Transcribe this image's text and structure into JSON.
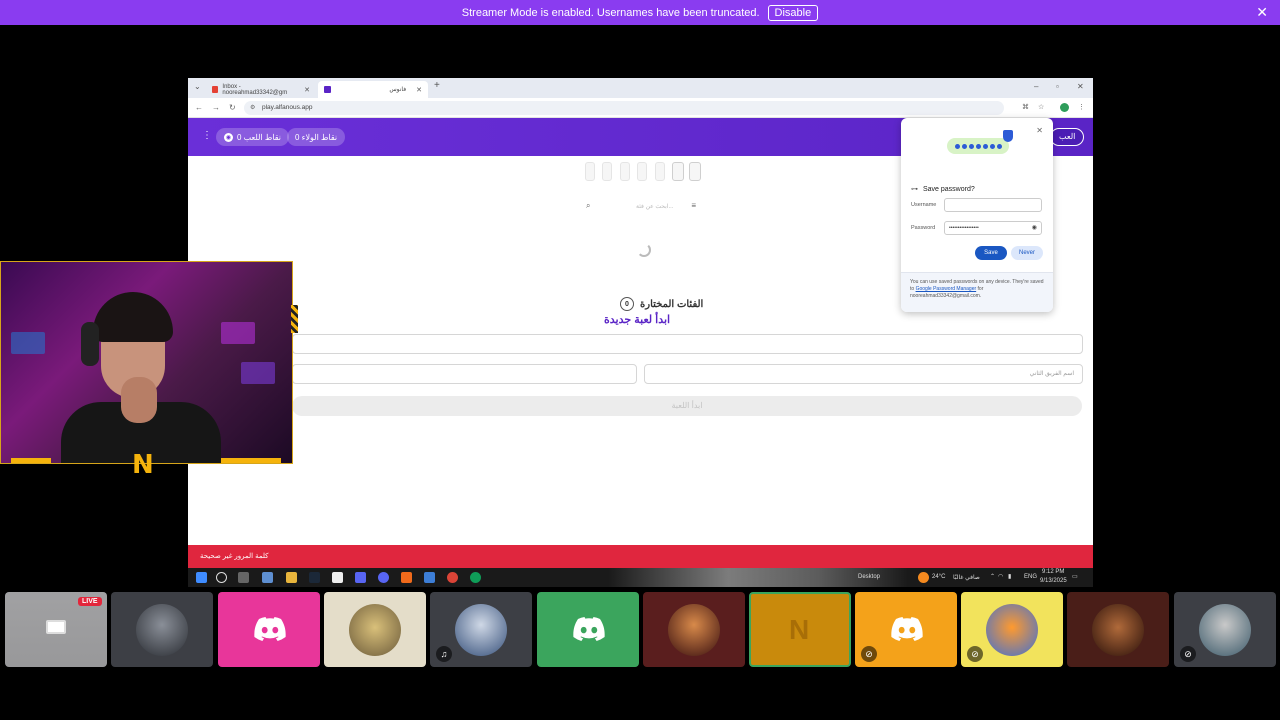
{
  "banner": {
    "message": "Streamer Mode is enabled. Usernames have been truncated.",
    "disable_label": "Disable",
    "close_glyph": "✕"
  },
  "browser": {
    "tabs": [
      {
        "title": "Inbox - nooreahmad33342@gm",
        "icon": "gmail-icon"
      },
      {
        "title": "فانوس",
        "icon": "app-icon"
      }
    ],
    "new_tab_glyph": "+",
    "url": "play.alfanous.app",
    "window_controls": [
      "–",
      "▫",
      "✕"
    ]
  },
  "app": {
    "menu_glyph": "⋮",
    "pills": [
      {
        "label": "نقاط اللعب 0",
        "icon": "points-icon"
      },
      {
        "label": "نقاط الولاء 0",
        "icon": "loyalty-icon"
      }
    ],
    "play_label": "العب",
    "search_placeholder": "ابحث عن فئة...",
    "selected_categories_label": "الفئات المختارة",
    "selected_categories_count": "0",
    "start_new_game": "ابدأ لعبة جديدة",
    "team2_placeholder": "اسم الفريق الثاني",
    "start_button": "ابدأ اللعبة",
    "toast": "كلمة المرور غير صحيحة"
  },
  "password_popup": {
    "title": "Save password?",
    "username_label": "Username",
    "username_value": "",
    "password_label": "Password",
    "password_value": "•••••••••••••••••",
    "save_label": "Save",
    "never_label": "Never",
    "footer_text": "You can use saved passwords on any device. They're saved to",
    "footer_link": "Google Password Manager",
    "footer_suffix": "for nooreahmad33342@gmail.com."
  },
  "taskbar": {
    "desktop_label": "Desktop",
    "weather": "24°C",
    "weather_desc": "صافي غالبًا",
    "lang": "ENG",
    "time": "9:12 PM",
    "date": "9/13/2025"
  },
  "participants": {
    "live_label": "LIVE"
  },
  "colors": {
    "banner": "#8a3cf0",
    "app_header": "#5a24c6",
    "toast": "#e0263e",
    "discord_pink": "#e8369a",
    "discord_green": "#3ba55d",
    "discord_orange": "#f4a21a",
    "cam_border": "#d6a51a"
  }
}
